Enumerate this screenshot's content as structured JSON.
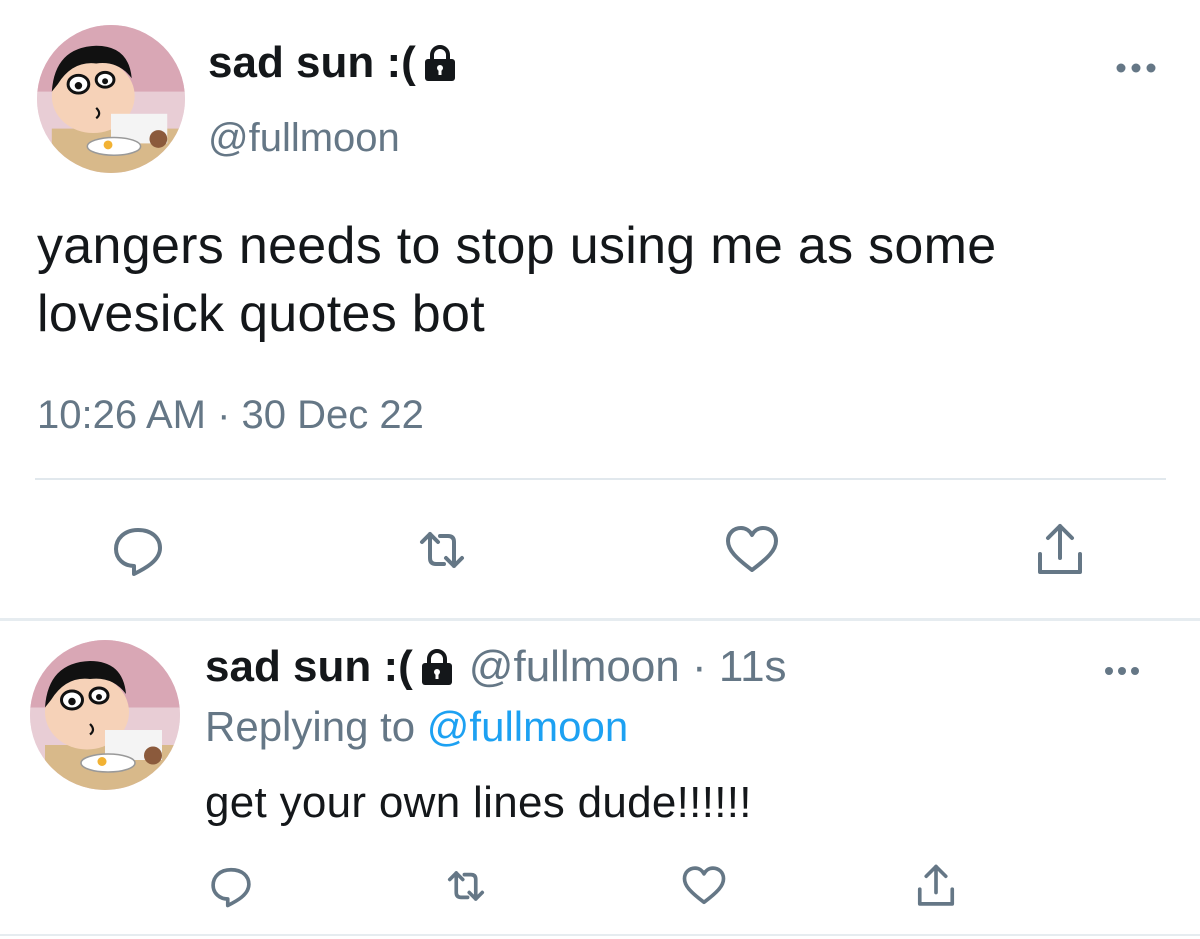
{
  "main_tweet": {
    "display_name": "sad sun :(",
    "handle": "@fullmoon",
    "text": "yangers needs to stop using me as some lovesick quotes bot",
    "timestamp": "10:26 AM · 30 Dec 22",
    "protected_icon": "lock-icon",
    "actions": [
      "reply-icon",
      "retweet-icon",
      "like-icon",
      "share-icon"
    ]
  },
  "reply_tweet": {
    "display_name": "sad sun :(",
    "handle_time": "@fullmoon · 11s",
    "replying_prefix": "Replying to",
    "replying_mention": "@fullmoon",
    "text": "get your own lines dude!!!!!!",
    "protected_icon": "lock-icon",
    "actions": [
      "reply-icon",
      "retweet-icon",
      "like-icon",
      "share-icon"
    ]
  },
  "colors": {
    "text": "#14171a",
    "secondary": "#657786",
    "link": "#1da1f2",
    "divider": "#e1e8ed"
  }
}
